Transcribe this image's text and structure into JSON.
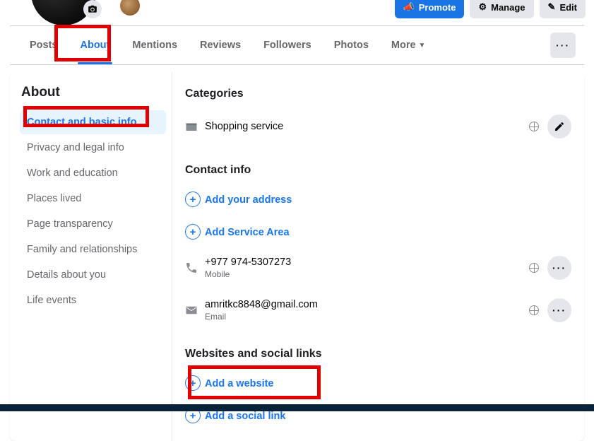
{
  "header": {
    "promote_label": "Promote",
    "manage_label": "Manage",
    "edit_label": "Edit"
  },
  "tabs": {
    "items": [
      {
        "label": "Posts"
      },
      {
        "label": "About"
      },
      {
        "label": "Mentions"
      },
      {
        "label": "Reviews"
      },
      {
        "label": "Followers"
      },
      {
        "label": "Photos"
      },
      {
        "label": "More"
      }
    ]
  },
  "sidebar": {
    "title": "About",
    "items": [
      {
        "label": "Contact and basic info"
      },
      {
        "label": "Privacy and legal info"
      },
      {
        "label": "Work and education"
      },
      {
        "label": "Places lived"
      },
      {
        "label": "Page transparency"
      },
      {
        "label": "Family and relationships"
      },
      {
        "label": "Details about you"
      },
      {
        "label": "Life events"
      }
    ]
  },
  "main": {
    "categories": {
      "title": "Categories",
      "value": "Shopping service"
    },
    "contact": {
      "title": "Contact info",
      "add_address": "Add your address",
      "add_service_area": "Add Service Area",
      "phone": {
        "number": "+977 974-5307273",
        "label": "Mobile"
      },
      "email": {
        "address": "amritkc8848@gmail.com",
        "label": "Email"
      }
    },
    "websites": {
      "title": "Websites and social links",
      "add_website": "Add a website",
      "add_social": "Add a social link"
    }
  }
}
